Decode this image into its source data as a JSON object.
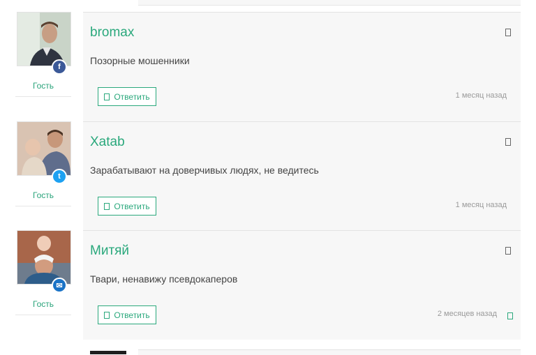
{
  "comments": [
    {
      "author": "bromax",
      "text": "Позорные мошенники",
      "role": "Гость",
      "reply_label": "Ответить",
      "time": "1 месяц назад",
      "avatar": "avatar-man-suit",
      "network_icon": "facebook-icon",
      "network_color": "#3b5998"
    },
    {
      "author": "Xatab",
      "text": "Зарабатывают на доверчивых людях, не ведитесь",
      "role": "Гость",
      "reply_label": "Ответить",
      "time": "1 месяц назад",
      "avatar": "avatar-man-child",
      "network_icon": "twitter-icon",
      "network_color": "#1da1f2"
    },
    {
      "author": "Митяй",
      "text": "Твари, ненавижу псевдокаперов",
      "role": "Гость",
      "reply_label": "Ответить",
      "time": "2 месяцев назад",
      "avatar": "avatar-family",
      "network_icon": "email-icon",
      "network_color": "#1a73c7"
    }
  ],
  "colors": {
    "accent": "#2aa87c",
    "muted": "#9a9a9a",
    "bg": "#f7f7f7"
  }
}
